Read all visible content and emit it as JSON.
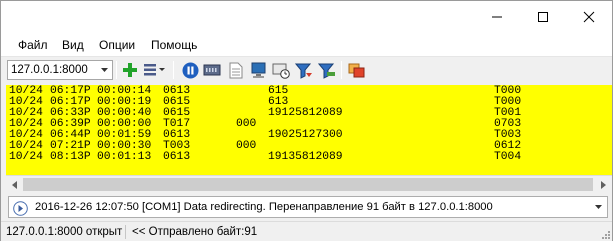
{
  "menu": {
    "items": [
      {
        "label": "Файл"
      },
      {
        "label": "Вид"
      },
      {
        "label": "Опции"
      },
      {
        "label": "Помощь"
      }
    ]
  },
  "toolbar": {
    "address_value": "127.0.0.1:8000",
    "icons": [
      "add-icon",
      "list-view-icon",
      "pause-icon",
      "device-icon",
      "document-icon",
      "computer-icon",
      "clock-device-icon",
      "filter-icon",
      "filter-arrow-icon",
      "copy-windows-icon"
    ]
  },
  "log": {
    "background": "#ffff00",
    "rows": [
      {
        "date": "10/24",
        "time": "06:17P",
        "duration": "00:00:14",
        "ext": "0613",
        "trunk": "",
        "number": "615",
        "code": "T000"
      },
      {
        "date": "10/24",
        "time": "06:17P",
        "duration": "00:00:19",
        "ext": "0615",
        "trunk": "",
        "number": "613",
        "code": "T000"
      },
      {
        "date": "10/24",
        "time": "06:33P",
        "duration": "00:00:40",
        "ext": "0615",
        "trunk": "",
        "number": "19125812089",
        "code": "T001"
      },
      {
        "date": "10/24",
        "time": "06:39P",
        "duration": "00:00:00",
        "ext": "T017",
        "trunk": "000",
        "number": "",
        "code": "0703"
      },
      {
        "date": "10/24",
        "time": "06:44P",
        "duration": "00:01:59",
        "ext": "0613",
        "trunk": "",
        "number": "19025127300",
        "code": "T003"
      },
      {
        "date": "10/24",
        "time": "07:21P",
        "duration": "00:00:30",
        "ext": "T003",
        "trunk": "000",
        "number": "",
        "code": "0612"
      },
      {
        "date": "10/24",
        "time": "08:13P",
        "duration": "00:01:13",
        "ext": "0613",
        "trunk": "",
        "number": "19135812089",
        "code": "T004"
      }
    ]
  },
  "message_bar": {
    "text": "2016-12-26 12:07:50 [COM1] Data redirecting. Перенаправление 91 байт в 127.0.0.1:8000"
  },
  "status": {
    "connection": "127.0.0.1:8000 открыт",
    "sent": "<< Отправлено байт:91"
  }
}
